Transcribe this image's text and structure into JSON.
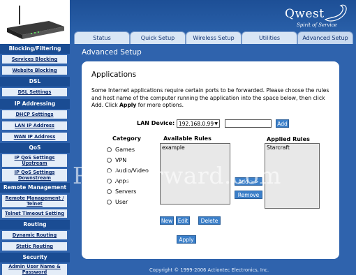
{
  "brand": {
    "name": "Qwest",
    "tagline": "Spirit of Service"
  },
  "tabs": [
    "Status",
    "Quick Setup",
    "Wireless Setup",
    "Utilities",
    "Advanced Setup"
  ],
  "sidebar": {
    "sections": [
      {
        "title": "Blocking/Filtering",
        "items": [
          "Services Blocking",
          "Website Blocking"
        ]
      },
      {
        "title": "DSL",
        "items": [
          "DSL Settings"
        ]
      },
      {
        "title": "IP Addressing",
        "items": [
          "DHCP Settings",
          "LAN IP Address",
          "WAN IP Address"
        ]
      },
      {
        "title": "QoS",
        "items": [
          "IP QoS Settings Upstream",
          "IP QoS Settings Downstream"
        ]
      },
      {
        "title": "Remote Management",
        "items": [
          "Remote Management / Telnet",
          "Telnet Timeout Setting"
        ]
      },
      {
        "title": "Routing",
        "items": [
          "Dynamic Routing",
          "Static Routing"
        ]
      },
      {
        "title": "Security",
        "items": [
          "Admin User Name & Password"
        ]
      }
    ]
  },
  "page": {
    "title": "Advanced Setup",
    "heading": "Applications",
    "description_1": "Some Internet applications require certain ports to be forwarded. Please choose the rules and host name of the computer running the application into the space below, then click Add. Click ",
    "description_bold": "Apply",
    "description_2": " for more options."
  },
  "lan_device": {
    "label": "LAN Device:",
    "value": "192.168.0.99",
    "add_label": "Add"
  },
  "category": {
    "label": "Category",
    "options": [
      "Games",
      "VPN",
      "Audio/Video",
      "Apps",
      "Servers",
      "User"
    ]
  },
  "available_rules": {
    "label": "Available Rules",
    "items": [
      "example"
    ]
  },
  "applied_rules": {
    "label": "Applied Rules",
    "items": [
      "Starcraft"
    ]
  },
  "buttons": {
    "add": "Add >>",
    "remove": "Remove",
    "new": "New",
    "edit": "Edit",
    "delete": "Delete",
    "apply": "Apply"
  },
  "watermark": "PortForward.com",
  "copyright": "Copyright © 1999-2006 Actiontec Electronics, Inc.",
  "colors": {
    "background": "#2f5f9f",
    "sidebar_header": "#1a4c93",
    "button": "#3b7fc9"
  }
}
